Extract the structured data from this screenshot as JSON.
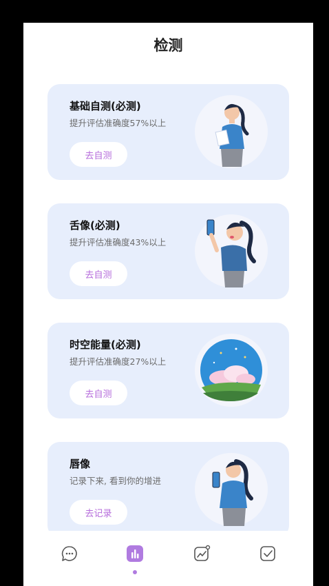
{
  "header": {
    "title": "检测"
  },
  "cards": [
    {
      "title": "基础自测(必测)",
      "subtitle": "提升评估准确度57%以上",
      "button": "去自测",
      "image": "woman-holding-paper-illustration"
    },
    {
      "title": "舌像(必测)",
      "subtitle": "提升评估准确度43%以上",
      "button": "去自测",
      "image": "woman-selfie-tongue-illustration"
    },
    {
      "title": "时空能量(必测)",
      "subtitle": "提升评估准确度27%以上",
      "button": "去自测",
      "image": "sky-clouds-landscape-illustration"
    },
    {
      "title": "唇像",
      "subtitle": "记录下来, 看到你的增进",
      "button": "去记录",
      "image": "woman-holding-phone-illustration"
    }
  ],
  "tabbar": {
    "tabs": [
      {
        "icon": "chat-bubble-icon",
        "active": false
      },
      {
        "icon": "bar-chart-icon",
        "active": true
      },
      {
        "icon": "trend-chart-icon",
        "active": false
      },
      {
        "icon": "checkbox-icon",
        "active": false
      }
    ]
  },
  "colors": {
    "accent": "#b07be0",
    "card_bg": "#e7eefc",
    "button_text": "#b56bdb"
  }
}
